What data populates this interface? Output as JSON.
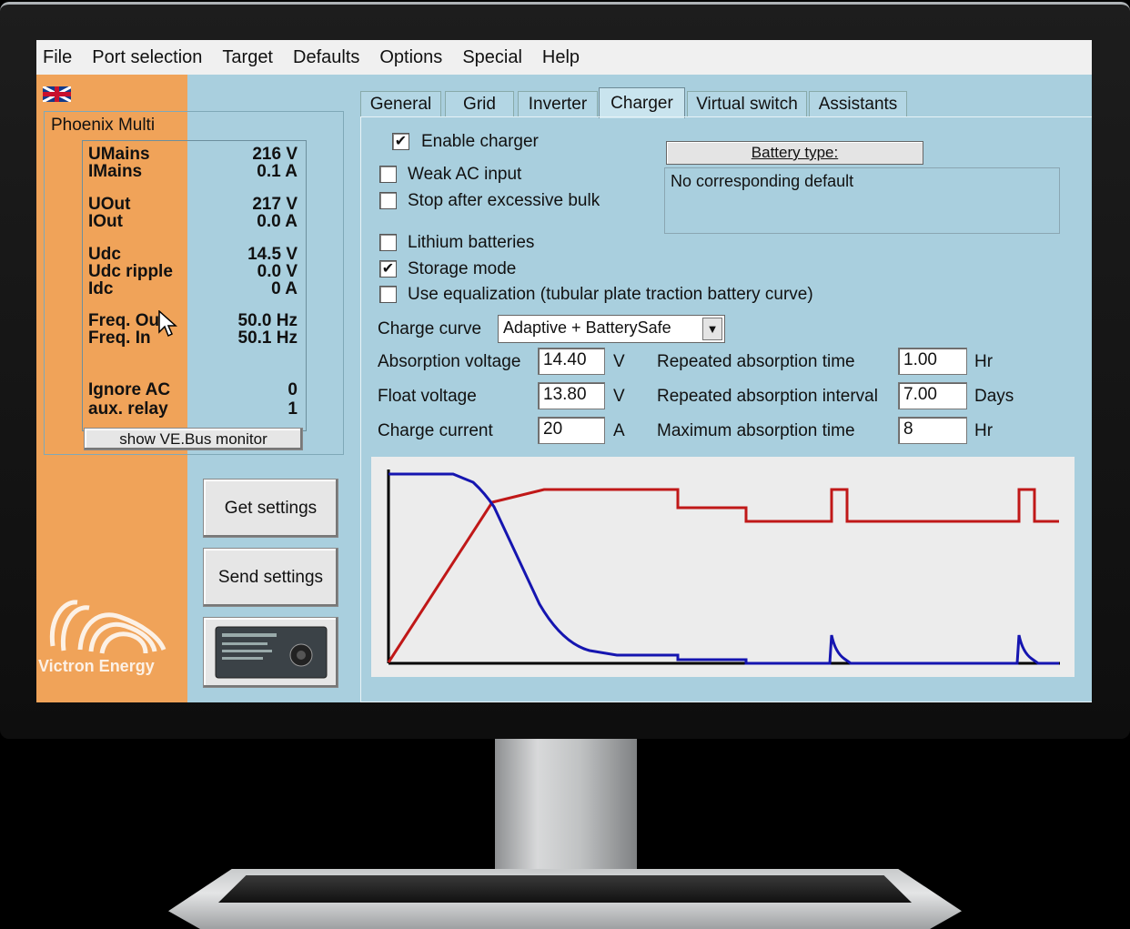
{
  "menu": [
    "File",
    "Port selection",
    "Target",
    "Defaults",
    "Options",
    "Special",
    "Help"
  ],
  "device": {
    "title": "Phoenix Multi",
    "readings": [
      {
        "label": "UMains",
        "value": "216 V"
      },
      {
        "label": "IMains",
        "value": "0.1 A"
      },
      {
        "label": "UOut",
        "value": "217 V"
      },
      {
        "label": "IOut",
        "value": "0.0 A"
      },
      {
        "label": "Udc",
        "value": "14.5 V"
      },
      {
        "label": "Udc ripple",
        "value": "0.0 V"
      },
      {
        "label": "Idc",
        "value": "0 A"
      },
      {
        "label": "Freq. Out",
        "value": "50.0 Hz"
      },
      {
        "label": "Freq. In",
        "value": "50.1 Hz"
      },
      {
        "label": "Ignore AC",
        "value": "0"
      },
      {
        "label": "aux. relay",
        "value": "1"
      }
    ],
    "monitor_button": "show VE.Bus monitor"
  },
  "buttons": {
    "get_settings": "Get settings",
    "send_settings": "Send settings"
  },
  "logo_text": "Victron Energy",
  "tabs": [
    "General",
    "Grid",
    "Inverter",
    "Charger",
    "Virtual switch",
    "Assistants"
  ],
  "active_tab": "Charger",
  "charger": {
    "checkboxes": [
      {
        "label": "Enable charger",
        "checked": true
      },
      {
        "label": "Weak AC input",
        "checked": false
      },
      {
        "label": "Stop after excessive bulk",
        "checked": false
      },
      {
        "label": "Lithium batteries",
        "checked": false
      },
      {
        "label": "Storage mode",
        "checked": true
      },
      {
        "label": "Use equalization (tubular plate traction battery curve)",
        "checked": false
      }
    ],
    "battery_type_button": "Battery type:",
    "battery_type_desc": "No corresponding default",
    "charge_curve_label": "Charge curve",
    "charge_curve_value": "Adaptive + BatterySafe",
    "params_left": [
      {
        "label": "Absorption voltage",
        "value": "14.40",
        "unit": "V"
      },
      {
        "label": "Float voltage",
        "value": "13.80",
        "unit": "V"
      },
      {
        "label": "Charge current",
        "value": "20",
        "unit": "A"
      }
    ],
    "params_right": [
      {
        "label": "Repeated absorption time",
        "value": "1.00",
        "unit": "Hr"
      },
      {
        "label": "Repeated absorption interval",
        "value": "7.00",
        "unit": "Days"
      },
      {
        "label": "Maximum absorption time",
        "value": "8",
        "unit": "Hr"
      }
    ]
  },
  "colors": {
    "voltage_curve": "#c01818",
    "current_curve": "#1515b0",
    "orange_panel": "#f0a359",
    "screen_bg": "#a9cfde"
  }
}
